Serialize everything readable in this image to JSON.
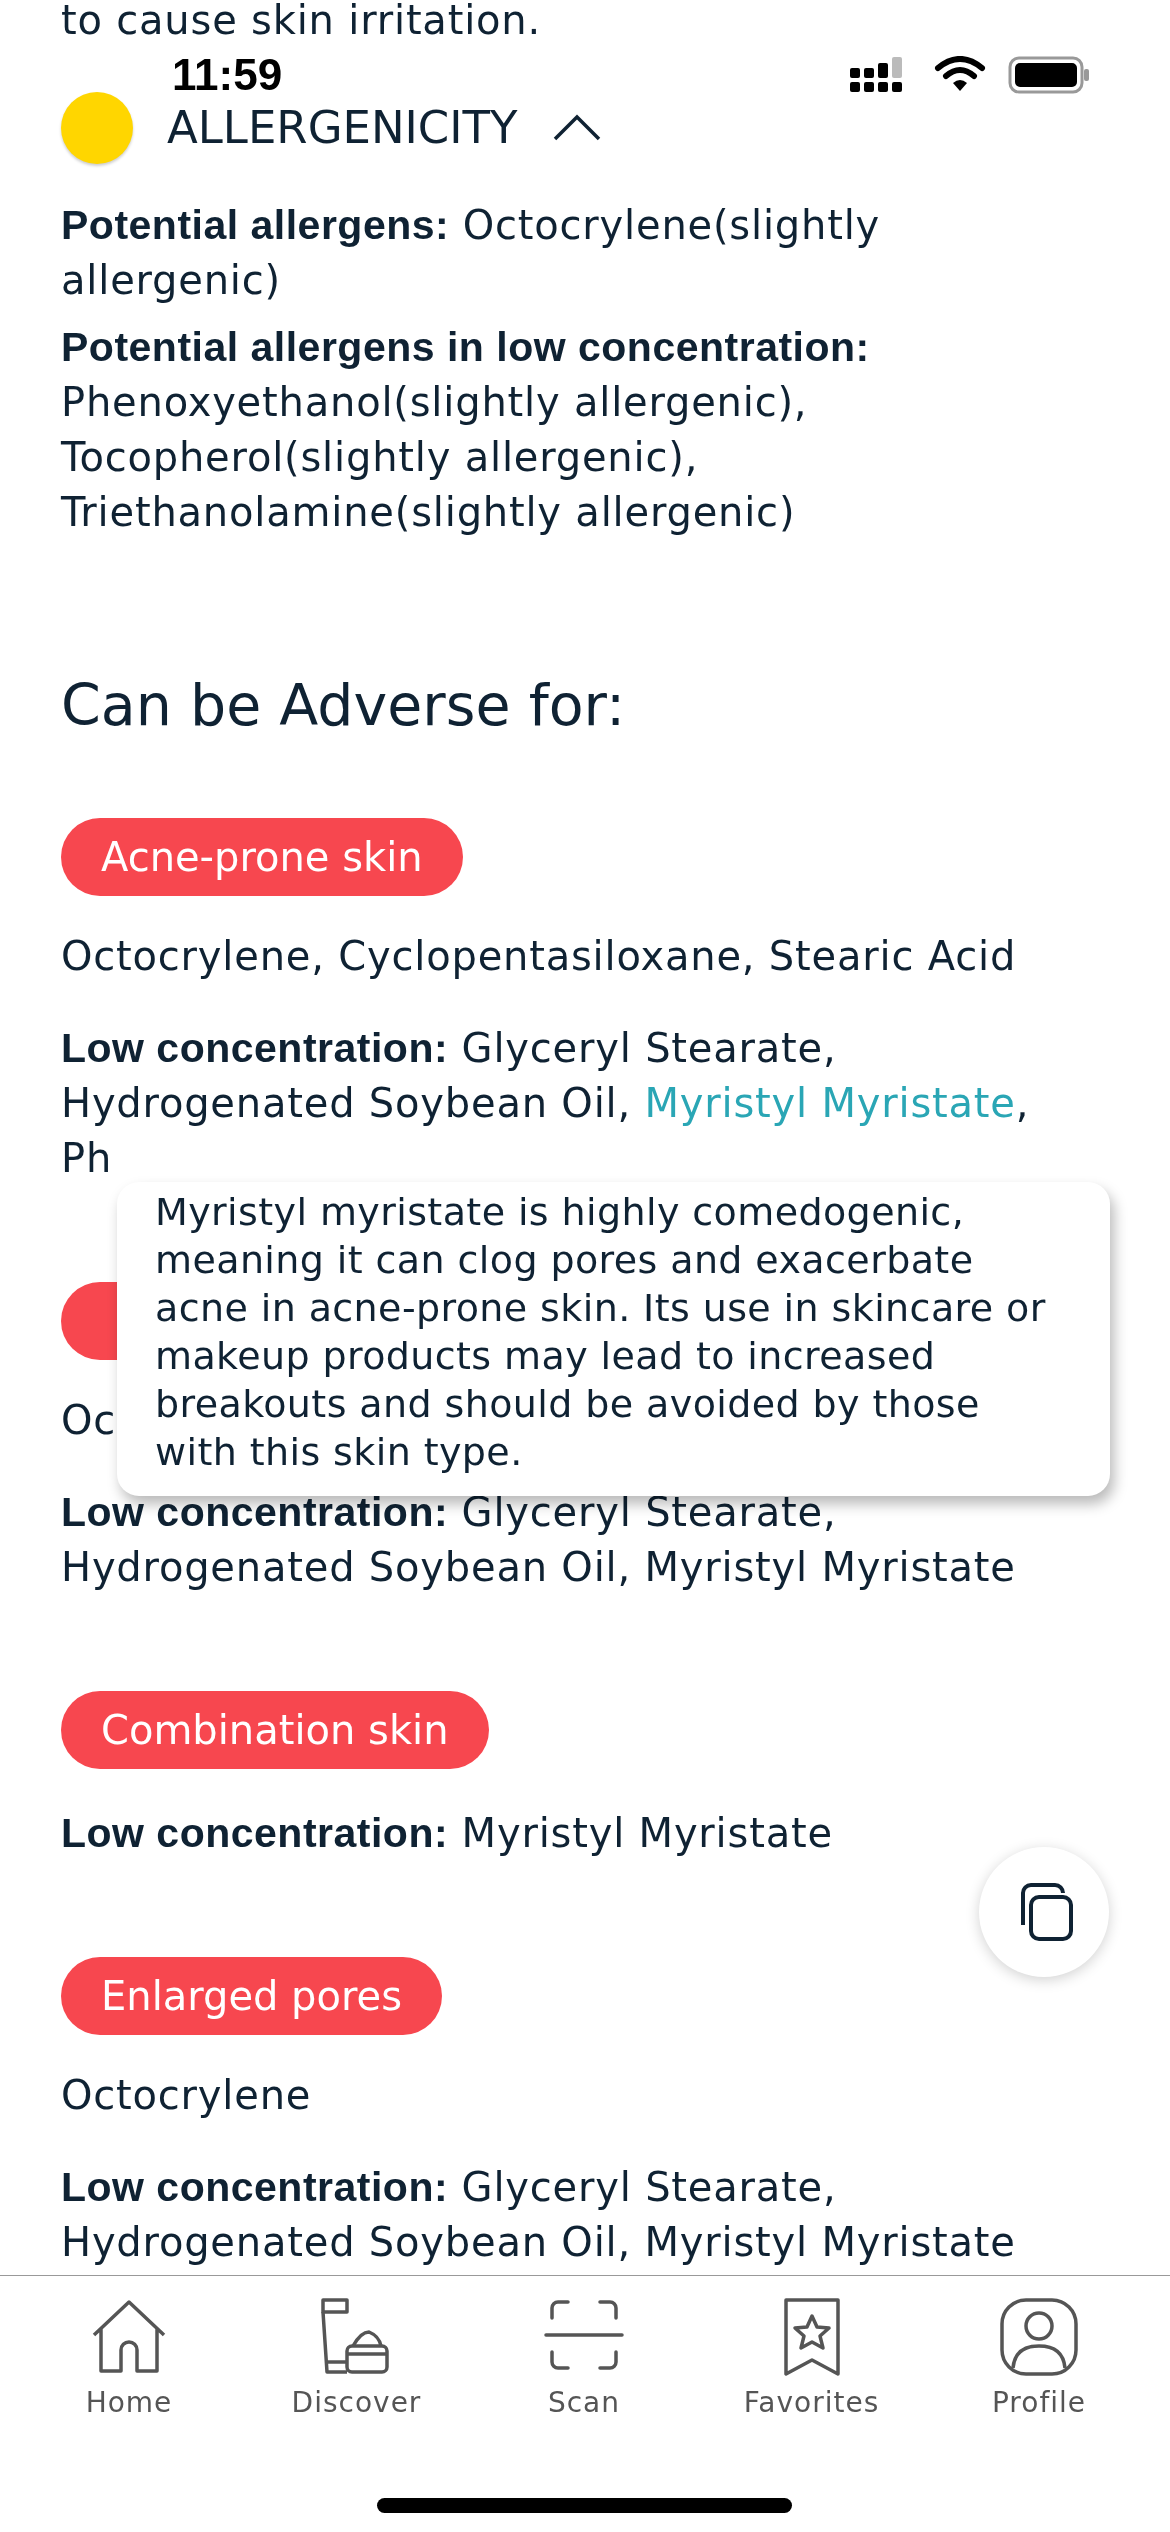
{
  "top_text": "to cause skin irritation.",
  "status_bar": {
    "time": "11:59"
  },
  "allergenicity": {
    "title": "ALLERGENICITY",
    "expanded": true,
    "lines": [
      {
        "label": "Potential allergens:",
        "text": "Octocrylene(slightly allergenic)"
      },
      {
        "label": "Potential allergens in low concentration:",
        "text": "Phenoxyethanol(slightly allergenic), Tocopherol(slightly allergenic), Triethanolamine(slightly allergenic)"
      }
    ]
  },
  "adverse": {
    "heading": "Can be Adverse for:",
    "groups": [
      {
        "kind": "full",
        "tag": "Acne-prone skin",
        "ingredients": "Octocrylene, Cyclopentasiloxane, Stearic Acid",
        "low_concentration": {
          "label": "Low concentration:",
          "text": "Glyceryl Stearate, Hydrogenated Soybean Oil,",
          "link": "Myristyl Myristate",
          "after": ",",
          "next_line": "Ph"
        }
      },
      {
        "kind": "covered",
        "ingredients": "Oc",
        "low_concentration": {
          "label": "Low concentration:",
          "text": "Glyceryl Stearate, Hydrogenated Soybean Oil, Myristyl Myristate"
        }
      },
      {
        "kind": "full",
        "tag": "Combination skin",
        "low_concentration": {
          "label": "Low concentration:",
          "text": "Myristyl Myristate"
        }
      },
      {
        "kind": "full",
        "tag": "Enlarged pores",
        "ingredients": "Octocrylene",
        "low_concentration": {
          "label": "Low concentration:",
          "text": "Glyceryl Stearate, Hydrogenated Soybean Oil, Myristyl Myristate"
        }
      }
    ]
  },
  "tooltip": {
    "text": "Myristyl myristate is highly comedogenic, meaning it can clog pores and exacerbate acne in acne-prone skin. Its use in skincare or makeup products may lead to increased breakouts and should be avoided by those with this skin type."
  },
  "tab_bar": [
    {
      "label": "Home"
    },
    {
      "label": "Discover"
    },
    {
      "label": "Scan"
    },
    {
      "label": "Favorites"
    },
    {
      "label": "Profile"
    }
  ]
}
